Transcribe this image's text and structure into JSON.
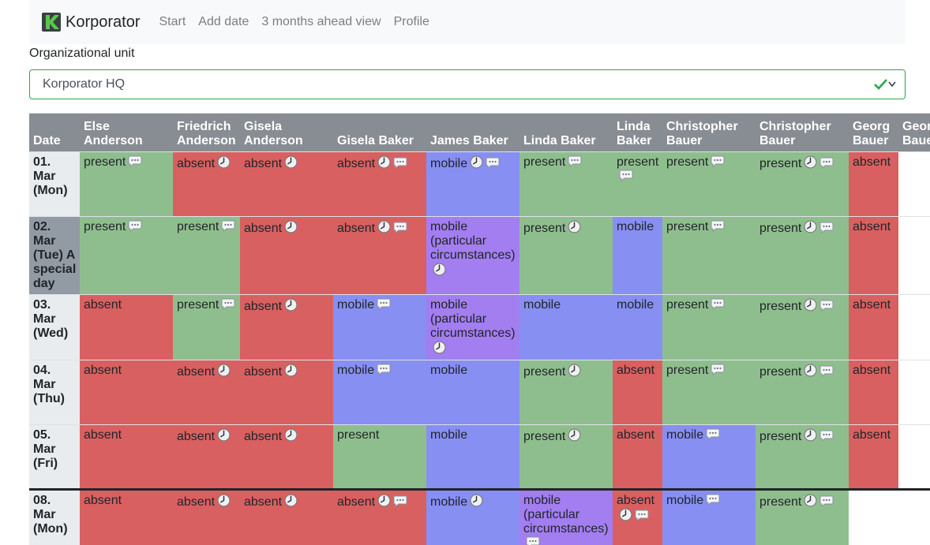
{
  "app": {
    "name": "Korporator"
  },
  "nav": {
    "items": [
      {
        "label": "Start",
        "name": "nav-start"
      },
      {
        "label": "Add date",
        "name": "nav-add-date"
      },
      {
        "label": "3 months ahead view",
        "name": "nav-3-months-ahead"
      },
      {
        "label": "Profile",
        "name": "nav-profile"
      }
    ]
  },
  "filter": {
    "label": "Organizational unit",
    "value": "Korporator HQ"
  },
  "colors": {
    "present": "#8fbe8e",
    "absent": "#d96060",
    "mobile": "#878ff2",
    "mobile_particular": "#a27ef0"
  },
  "table": {
    "date_header": "Date",
    "columns": [
      "Else Anderson",
      "Friedrich Anderson",
      "Gisela Anderson",
      "Gisela Baker",
      "James Baker",
      "Linda Baker",
      "Linda Baker",
      "Christopher Bauer",
      "Christopher Bauer",
      "Georg Bauer",
      "Georg Bauer"
    ],
    "rows": [
      {
        "date": "01. Mar (Mon)",
        "special": false,
        "week_break": false,
        "cells": [
          {
            "status": "present",
            "clock": false,
            "comment": true
          },
          {
            "status": "absent",
            "clock": true,
            "comment": false
          },
          {
            "status": "absent",
            "clock": true,
            "comment": false
          },
          {
            "status": "absent",
            "clock": true,
            "comment": true
          },
          {
            "status": "mobile",
            "clock": true,
            "comment": true
          },
          {
            "status": "present",
            "clock": false,
            "comment": true
          },
          {
            "status": "present",
            "clock": false,
            "comment": true
          },
          {
            "status": "present",
            "clock": false,
            "comment": true
          },
          {
            "status": "present",
            "clock": true,
            "comment": true
          },
          {
            "status": "absent",
            "clock": false,
            "comment": false
          },
          {
            "status": "none"
          }
        ]
      },
      {
        "date": "02. Mar (Tue) A special day",
        "special": true,
        "week_break": false,
        "cells": [
          {
            "status": "present",
            "clock": false,
            "comment": true
          },
          {
            "status": "present",
            "clock": false,
            "comment": true
          },
          {
            "status": "absent",
            "clock": true,
            "comment": false
          },
          {
            "status": "absent",
            "clock": true,
            "comment": true
          },
          {
            "status": "mobile (particular circumstances)",
            "clock": true,
            "comment": false
          },
          {
            "status": "present",
            "clock": true,
            "comment": false
          },
          {
            "status": "mobile",
            "clock": false,
            "comment": false
          },
          {
            "status": "present",
            "clock": false,
            "comment": true
          },
          {
            "status": "present",
            "clock": true,
            "comment": true
          },
          {
            "status": "absent",
            "clock": false,
            "comment": false
          },
          {
            "status": "none"
          }
        ]
      },
      {
        "date": "03. Mar (Wed)",
        "special": false,
        "week_break": false,
        "cells": [
          {
            "status": "absent",
            "clock": false,
            "comment": false
          },
          {
            "status": "present",
            "clock": false,
            "comment": true
          },
          {
            "status": "absent",
            "clock": true,
            "comment": false
          },
          {
            "status": "mobile",
            "clock": false,
            "comment": true
          },
          {
            "status": "mobile (particular circumstances)",
            "clock": true,
            "comment": false
          },
          {
            "status": "mobile",
            "clock": false,
            "comment": false
          },
          {
            "status": "mobile",
            "clock": false,
            "comment": false
          },
          {
            "status": "present",
            "clock": false,
            "comment": true
          },
          {
            "status": "present",
            "clock": true,
            "comment": true
          },
          {
            "status": "absent",
            "clock": false,
            "comment": false
          },
          {
            "status": "none"
          }
        ]
      },
      {
        "date": "04. Mar (Thu)",
        "special": false,
        "week_break": false,
        "cells": [
          {
            "status": "absent",
            "clock": false,
            "comment": false
          },
          {
            "status": "absent",
            "clock": true,
            "comment": false
          },
          {
            "status": "absent",
            "clock": true,
            "comment": false
          },
          {
            "status": "mobile",
            "clock": false,
            "comment": true
          },
          {
            "status": "mobile",
            "clock": false,
            "comment": false
          },
          {
            "status": "present",
            "clock": true,
            "comment": false
          },
          {
            "status": "absent",
            "clock": false,
            "comment": false
          },
          {
            "status": "present",
            "clock": false,
            "comment": true
          },
          {
            "status": "present",
            "clock": true,
            "comment": true
          },
          {
            "status": "absent",
            "clock": false,
            "comment": false
          },
          {
            "status": "none"
          }
        ]
      },
      {
        "date": "05. Mar (Fri)",
        "special": false,
        "week_break": false,
        "cells": [
          {
            "status": "absent",
            "clock": false,
            "comment": false
          },
          {
            "status": "absent",
            "clock": true,
            "comment": false
          },
          {
            "status": "absent",
            "clock": true,
            "comment": false
          },
          {
            "status": "present",
            "clock": false,
            "comment": false
          },
          {
            "status": "mobile",
            "clock": false,
            "comment": false
          },
          {
            "status": "present",
            "clock": true,
            "comment": false
          },
          {
            "status": "absent",
            "clock": false,
            "comment": false
          },
          {
            "status": "mobile",
            "clock": false,
            "comment": true
          },
          {
            "status": "present",
            "clock": true,
            "comment": true
          },
          {
            "status": "absent",
            "clock": false,
            "comment": false
          },
          {
            "status": "none"
          }
        ]
      },
      {
        "date": "08. Mar (Mon)",
        "special": false,
        "week_break": true,
        "cells": [
          {
            "status": "absent",
            "clock": false,
            "comment": false
          },
          {
            "status": "absent",
            "clock": true,
            "comment": false
          },
          {
            "status": "absent",
            "clock": true,
            "comment": false
          },
          {
            "status": "absent",
            "clock": true,
            "comment": true
          },
          {
            "status": "mobile",
            "clock": true,
            "comment": false
          },
          {
            "status": "mobile (particular circumstances)",
            "clock": false,
            "comment": true
          },
          {
            "status": "absent",
            "clock": true,
            "comment": true
          },
          {
            "status": "mobile",
            "clock": false,
            "comment": true
          },
          {
            "status": "present",
            "clock": true,
            "comment": true
          },
          {
            "status": "none"
          },
          {
            "status": "none"
          }
        ]
      }
    ]
  }
}
